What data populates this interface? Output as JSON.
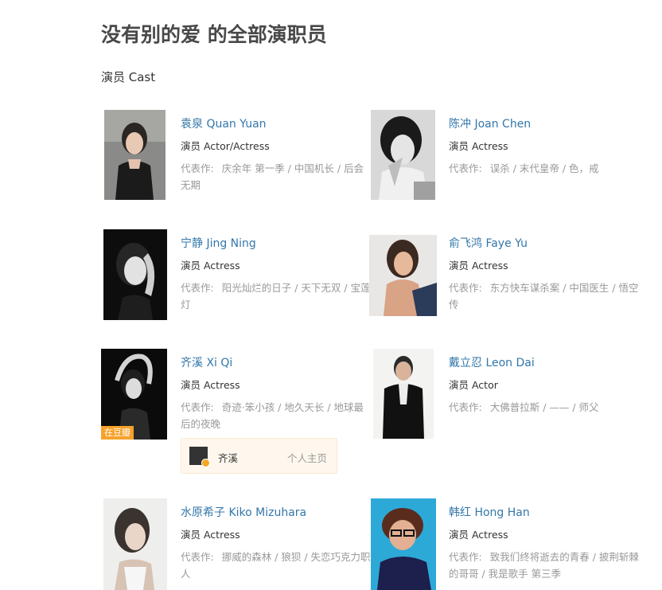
{
  "page_title": "没有别的爱 的全部演职员",
  "section_title": "演员 Cast",
  "works_label": "代表作:",
  "cast": [
    {
      "name": "袁泉 Quan Yuan",
      "role": "演员 Actor/Actress",
      "works": "庆余年 第一季 / 中国机长 / 后会无期"
    },
    {
      "name": "陈冲 Joan Chen",
      "role": "演员 Actress",
      "works": "误杀 / 末代皇帝 / 色，戒"
    },
    {
      "name": "宁静 Jing Ning",
      "role": "演员 Actress",
      "works": "阳光灿烂的日子 / 天下无双 / 宝莲灯"
    },
    {
      "name": "俞飞鸿 Faye Yu",
      "role": "演员 Actress",
      "works": "东方快车谋杀案 / 中国医生 / 悟空传"
    },
    {
      "name": "齐溪 Xi Qi",
      "role": "演员 Actress",
      "works": "奇迹·笨小孩 / 地久天长 / 地球最后的夜晚",
      "badge": "在豆瓣",
      "profile": {
        "name": "齐溪",
        "link": "个人主页"
      }
    },
    {
      "name": "戴立忍 Leon Dai",
      "role": "演员 Actor",
      "works": "大佛普拉斯 / —— / 师父"
    },
    {
      "name": "水原希子 Kiko Mizuhara",
      "role": "演员 Actress",
      "works": "挪威的森林 / 狼狈 / 失恋巧克力职人"
    },
    {
      "name": "韩红 Hong Han",
      "role": "演员 Actress",
      "works": "致我们终将逝去的青春 / 披荆斩棘的哥哥 / 我是歌手 第三季"
    }
  ]
}
